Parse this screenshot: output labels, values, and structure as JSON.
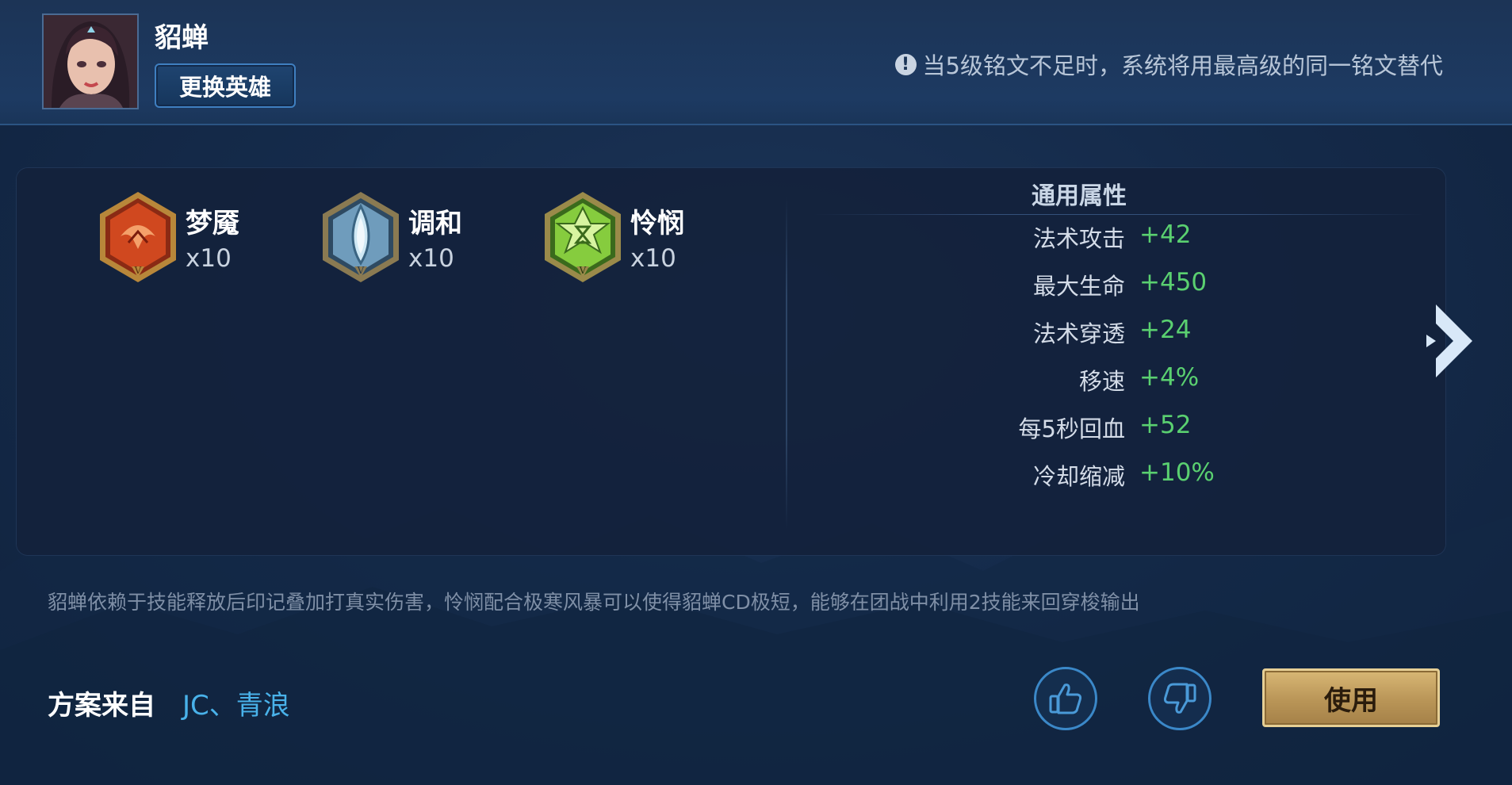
{
  "hero": {
    "name": "貂蝉",
    "change_button": "更换英雄"
  },
  "notice": {
    "icon": "exclamation-icon",
    "text": "当5级铭文不足时，系统将用最高级的同一铭文替代"
  },
  "runes": [
    {
      "name": "梦魇",
      "count": "x10",
      "color": "#c8421e",
      "icon": "red-hexagon-rune-icon"
    },
    {
      "name": "调和",
      "count": "x10",
      "color": "#7fb8d8",
      "icon": "blue-teardrop-rune-icon"
    },
    {
      "name": "怜悯",
      "count": "x10",
      "color": "#7dc43c",
      "icon": "green-star-rune-icon"
    }
  ],
  "stats": {
    "title": "通用属性",
    "rows": [
      {
        "label": "法术攻击",
        "value": "+42"
      },
      {
        "label": "最大生命",
        "value": "+450"
      },
      {
        "label": "法术穿透",
        "value": "+24"
      },
      {
        "label": "移速",
        "value": "+4%"
      },
      {
        "label": "每5秒回血",
        "value": "+52"
      },
      {
        "label": "冷却缩减",
        "value": "+10%"
      }
    ]
  },
  "description": "貂蝉依赖于技能释放后印记叠加打真实伤害，怜悯配合极寒风暴可以使得貂蝉CD极短，能够在团战中利用2技能来回穿梭输出",
  "author": {
    "label": "方案来自",
    "name": "JC、青浪"
  },
  "actions": {
    "use_label": "使用",
    "like_icon": "thumbs-up-icon",
    "dislike_icon": "thumbs-down-icon",
    "next_icon": "chevron-right-icon"
  },
  "colors": {
    "stat_value": "#5ad070",
    "author_name": "#49b2ea",
    "use_button": "#c8a462"
  }
}
